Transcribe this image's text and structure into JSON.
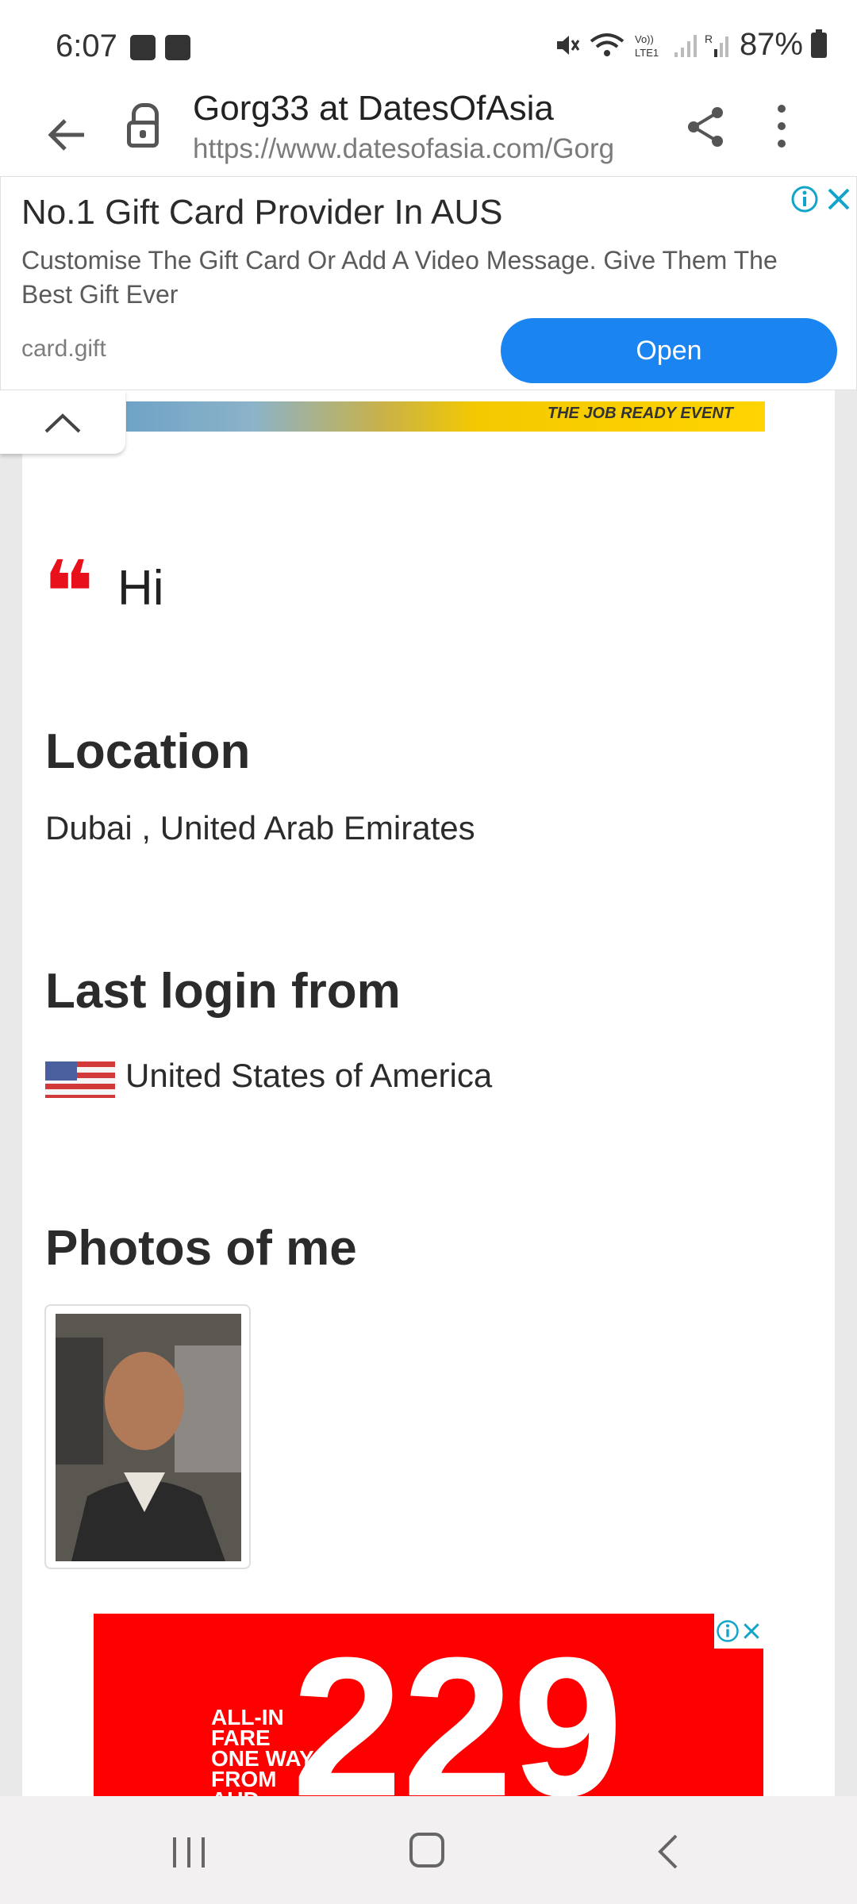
{
  "status_bar": {
    "time": "6:07",
    "battery": "87%",
    "icons": [
      "image-icon",
      "check-box-icon",
      "mute-icon",
      "wifi-icon",
      "volte-icon",
      "signal-icon",
      "signal-roaming-icon",
      "battery-icon"
    ]
  },
  "browser": {
    "page_title": "Gorg33 at DatesOfAsia",
    "url": "https://www.datesofasia.com/Gorg"
  },
  "ad_banner": {
    "title": "No.1 Gift Card Provider In AUS",
    "description": "Customise The Gift Card Or Add A Video Message. Give Them The Best Gift Ever",
    "domain": "card.gift",
    "cta_label": "Open",
    "cta_color": "#1a84f0"
  },
  "profile": {
    "top_strip_text": "THE JOB READY EVENT",
    "greeting": "Hi",
    "location_heading": "Location",
    "location_value": "Dubai , United Arab Emirates",
    "last_login_heading": "Last login from",
    "last_login_value": "United States of America",
    "photos_heading": "Photos of me",
    "quote_color": "#e8101b"
  },
  "bottom_ad": {
    "small_text_line1": "ALL-IN",
    "small_text_line2": "FARE",
    "small_text_line3": "ONE WAY",
    "small_text_line4": "FROM",
    "small_text_line5": "AUD",
    "price": "229",
    "background_color": "#fe0000"
  }
}
